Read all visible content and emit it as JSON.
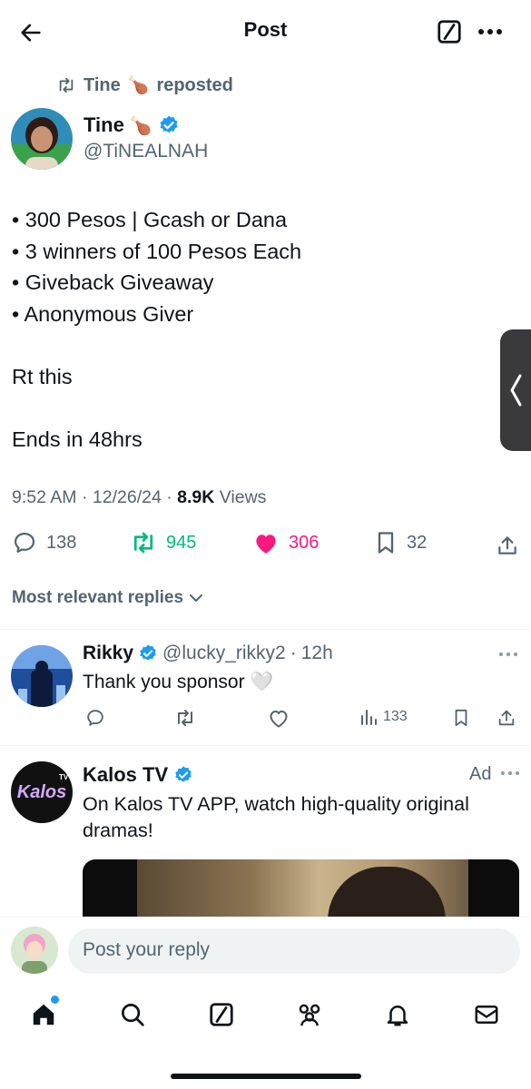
{
  "header": {
    "title": "Post"
  },
  "repost": {
    "user": "Tine",
    "emoji": "🍗",
    "label": "reposted"
  },
  "post": {
    "author_name": "Tine",
    "author_emoji": "🍗",
    "handle": "@TiNEALNAH",
    "lines": [
      "• 300 Pesos | Gcash or Dana",
      "• 3 winners of 100 Pesos Each",
      "• Giveback Giveaway",
      "• Anonymous Giver",
      "",
      "Rt this",
      "",
      "Ends in 48hrs"
    ],
    "time": "9:52 AM",
    "date": "12/26/24",
    "views_count": "8.9K",
    "views_label": "Views",
    "stats": {
      "replies": "138",
      "reposts": "945",
      "likes": "306",
      "bookmarks": "32"
    }
  },
  "replies_filter": {
    "label": "Most relevant replies"
  },
  "reply": {
    "name": "Rikky",
    "handle": "@lucky_rikky2",
    "age": "12h",
    "text": "Thank you sponsor 🤍",
    "views": "133"
  },
  "ad": {
    "name": "Kalos TV",
    "badge": "Ad",
    "text_line1": "On Kalos TV APP, watch high-quality original",
    "text_line2": "dramas!",
    "logo_text": "Kalos",
    "logo_small": "TV"
  },
  "composer": {
    "placeholder": "Post your reply"
  },
  "colors": {
    "accent": "#1d9bf0",
    "repost_green": "#00ba7c",
    "like_pink": "#f91880",
    "muted": "#536471"
  }
}
